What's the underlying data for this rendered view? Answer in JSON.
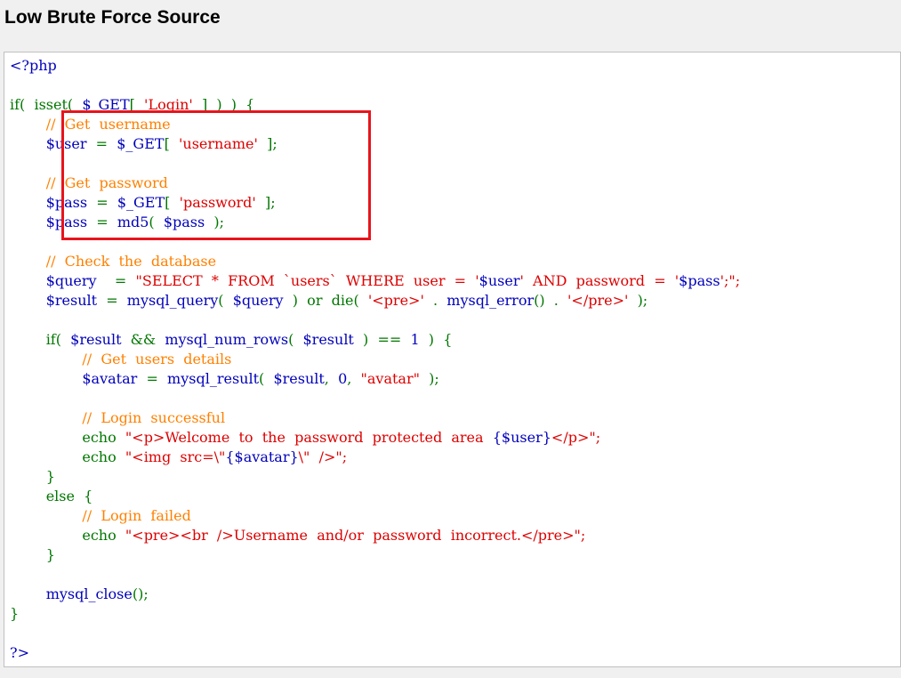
{
  "page": {
    "title": "Low Brute Force Source"
  },
  "code_lines": [
    [
      {
        "t": "<?php",
        "c": "var"
      }
    ],
    [],
    [
      {
        "t": "if(  ",
        "c": "kw"
      },
      {
        "t": "isset(  ",
        "c": "kw"
      },
      {
        "t": "$_GET",
        "c": "var"
      },
      {
        "t": "[  ",
        "c": "kw"
      },
      {
        "t": "'Login'",
        "c": "str"
      },
      {
        "t": "  ]  )  )  {",
        "c": "kw"
      }
    ],
    [
      {
        "t": "        ",
        "c": "var"
      },
      {
        "t": "//  Get  username",
        "c": "cm"
      }
    ],
    [
      {
        "t": "        ",
        "c": "var"
      },
      {
        "t": "$user",
        "c": "var"
      },
      {
        "t": "  =  ",
        "c": "kw"
      },
      {
        "t": "$_GET",
        "c": "var"
      },
      {
        "t": "[  ",
        "c": "kw"
      },
      {
        "t": "'username'",
        "c": "str"
      },
      {
        "t": "  ];",
        "c": "kw"
      }
    ],
    [],
    [
      {
        "t": "        ",
        "c": "var"
      },
      {
        "t": "//  Get  password",
        "c": "cm"
      }
    ],
    [
      {
        "t": "        ",
        "c": "var"
      },
      {
        "t": "$pass",
        "c": "var"
      },
      {
        "t": "  =  ",
        "c": "kw"
      },
      {
        "t": "$_GET",
        "c": "var"
      },
      {
        "t": "[  ",
        "c": "kw"
      },
      {
        "t": "'password'",
        "c": "str"
      },
      {
        "t": "  ];",
        "c": "kw"
      }
    ],
    [
      {
        "t": "        ",
        "c": "var"
      },
      {
        "t": "$pass",
        "c": "var"
      },
      {
        "t": "  =  ",
        "c": "kw"
      },
      {
        "t": "md5",
        "c": "var"
      },
      {
        "t": "(  ",
        "c": "kw"
      },
      {
        "t": "$pass",
        "c": "var"
      },
      {
        "t": "  );",
        "c": "kw"
      }
    ],
    [],
    [
      {
        "t": "        ",
        "c": "var"
      },
      {
        "t": "//  Check  the  database",
        "c": "cm"
      }
    ],
    [
      {
        "t": "        ",
        "c": "var"
      },
      {
        "t": "$query",
        "c": "var"
      },
      {
        "t": "    =  ",
        "c": "kw"
      },
      {
        "t": "\"SELECT  *  FROM  `users`  WHERE  user  =  '",
        "c": "str"
      },
      {
        "t": "$user",
        "c": "var"
      },
      {
        "t": "'  AND  password  =  '",
        "c": "str"
      },
      {
        "t": "$pass",
        "c": "var"
      },
      {
        "t": "';\";",
        "c": "str"
      }
    ],
    [
      {
        "t": "        ",
        "c": "var"
      },
      {
        "t": "$result",
        "c": "var"
      },
      {
        "t": "  =  ",
        "c": "kw"
      },
      {
        "t": "mysql_query",
        "c": "var"
      },
      {
        "t": "(  ",
        "c": "kw"
      },
      {
        "t": "$query",
        "c": "var"
      },
      {
        "t": "  )  or  die(  ",
        "c": "kw"
      },
      {
        "t": "'<pre>'",
        "c": "str"
      },
      {
        "t": "  .  ",
        "c": "kw"
      },
      {
        "t": "mysql_error",
        "c": "var"
      },
      {
        "t": "()  .  ",
        "c": "kw"
      },
      {
        "t": "'</pre>'",
        "c": "str"
      },
      {
        "t": "  );",
        "c": "kw"
      }
    ],
    [],
    [
      {
        "t": "        ",
        "c": "var"
      },
      {
        "t": "if(  ",
        "c": "kw"
      },
      {
        "t": "$result",
        "c": "var"
      },
      {
        "t": "  &&  ",
        "c": "kw"
      },
      {
        "t": "mysql_num_rows",
        "c": "var"
      },
      {
        "t": "(  ",
        "c": "kw"
      },
      {
        "t": "$result",
        "c": "var"
      },
      {
        "t": "  )  ==  ",
        "c": "kw"
      },
      {
        "t": "1",
        "c": "var"
      },
      {
        "t": "  )  {",
        "c": "kw"
      }
    ],
    [
      {
        "t": "                ",
        "c": "var"
      },
      {
        "t": "//  Get  users  details",
        "c": "cm"
      }
    ],
    [
      {
        "t": "                ",
        "c": "var"
      },
      {
        "t": "$avatar",
        "c": "var"
      },
      {
        "t": "  =  ",
        "c": "kw"
      },
      {
        "t": "mysql_result",
        "c": "var"
      },
      {
        "t": "(  ",
        "c": "kw"
      },
      {
        "t": "$result",
        "c": "var"
      },
      {
        "t": ",  ",
        "c": "kw"
      },
      {
        "t": "0",
        "c": "var"
      },
      {
        "t": ",  ",
        "c": "kw"
      },
      {
        "t": "\"avatar\"",
        "c": "str"
      },
      {
        "t": "  );",
        "c": "kw"
      }
    ],
    [],
    [
      {
        "t": "                ",
        "c": "var"
      },
      {
        "t": "//  Login  successful",
        "c": "cm"
      }
    ],
    [
      {
        "t": "                ",
        "c": "var"
      },
      {
        "t": "echo  ",
        "c": "kw"
      },
      {
        "t": "\"<p>Welcome  to  the  password  protected  area  ",
        "c": "str"
      },
      {
        "t": "{$user}",
        "c": "var"
      },
      {
        "t": "</p>\";",
        "c": "str"
      }
    ],
    [
      {
        "t": "                ",
        "c": "var"
      },
      {
        "t": "echo  ",
        "c": "kw"
      },
      {
        "t": "\"<img  src=\\\"",
        "c": "str"
      },
      {
        "t": "{$avatar}",
        "c": "var"
      },
      {
        "t": "\\\"  />\";",
        "c": "str"
      }
    ],
    [
      {
        "t": "        ",
        "c": "var"
      },
      {
        "t": "}",
        "c": "kw"
      }
    ],
    [
      {
        "t": "        ",
        "c": "var"
      },
      {
        "t": "else  {",
        "c": "kw"
      }
    ],
    [
      {
        "t": "                ",
        "c": "var"
      },
      {
        "t": "//  Login  failed",
        "c": "cm"
      }
    ],
    [
      {
        "t": "                ",
        "c": "var"
      },
      {
        "t": "echo  ",
        "c": "kw"
      },
      {
        "t": "\"<pre><br  />Username  and/or  password  incorrect.</pre>\";",
        "c": "str"
      }
    ],
    [
      {
        "t": "        ",
        "c": "var"
      },
      {
        "t": "}",
        "c": "kw"
      }
    ],
    [],
    [
      {
        "t": "        ",
        "c": "var"
      },
      {
        "t": "mysql_close",
        "c": "var"
      },
      {
        "t": "();",
        "c": "kw"
      }
    ],
    [
      {
        "t": "}",
        "c": "kw"
      }
    ],
    [],
    [
      {
        "t": "?>",
        "c": "var"
      }
    ]
  ],
  "colors": {
    "variable": "#0000bb",
    "keyword": "#007700",
    "string": "#dd0000",
    "comment": "#ff8000",
    "highlight_border": "#e8141c"
  }
}
